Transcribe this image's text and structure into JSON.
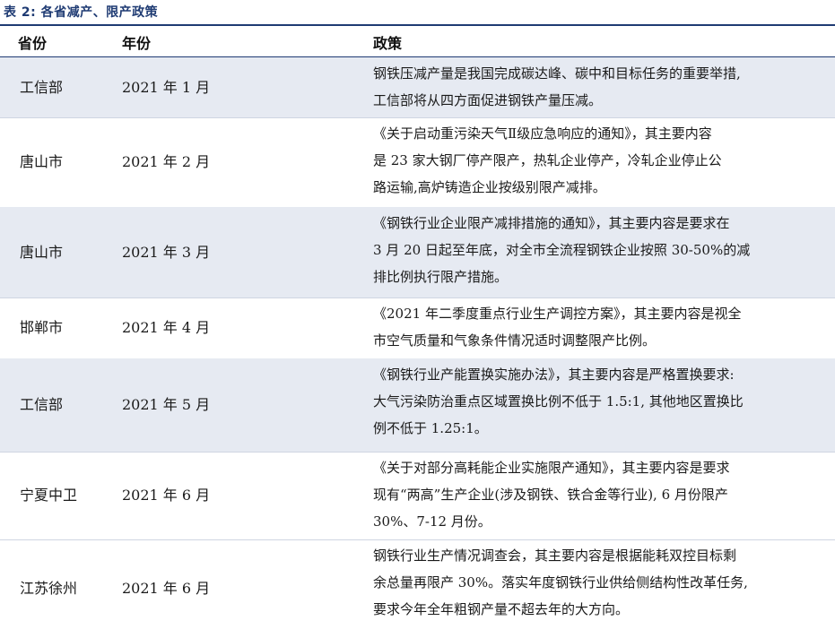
{
  "caption": "表 2: 各省减产、限产政策",
  "headers": {
    "province": "省份",
    "date": "年份",
    "policy": "政策"
  },
  "rows": [
    {
      "province": "工信部",
      "date": "2021 年 1 月",
      "lines": [
        "钢铁压减产量是我国完成碳达峰、碳中和目标任务的重要举措,",
        "工信部将从四方面促进钢铁产量压减。"
      ]
    },
    {
      "province": "唐山市",
      "date": "2021 年 2 月",
      "lines": [
        "《关于启动重污染天气Ⅱ级应急响应的通知》，其主要内容",
        "是 23 家大钢厂停产限产，热轧企业停产，冷轧企业停止公",
        "路运输,高炉铸造企业按级别限产减排。"
      ]
    },
    {
      "province": "唐山市",
      "date": "2021 年 3 月",
      "lines": [
        "《钢铁行业企业限产减排措施的通知》，其主要内容是要求在",
        "3 月 20 日起至年底，对全市全流程钢铁企业按照 30-50%的减",
        "排比例执行限产措施。"
      ]
    },
    {
      "province": "邯郸市",
      "date": "2021 年 4 月",
      "lines": [
        "《2021 年二季度重点行业生产调控方案》，其主要内容是视全",
        "市空气质量和气象条件情况适时调整限产比例。"
      ]
    },
    {
      "province": "工信部",
      "date": "2021 年 5 月",
      "lines": [
        "《钢铁行业产能置换实施办法》，其主要内容是严格置换要求:",
        "大气污染防治重点区域置换比例不低于 1.5:1, 其他地区置换比",
        "例不低于 1.25:1。"
      ]
    },
    {
      "province": "宁夏中卫",
      "date": "2021 年 6 月",
      "lines": [
        "《关于对部分高耗能企业实施限产通知》，其主要内容是要求",
        "现有“两高”生产企业(涉及钢铁、铁合金等行业), 6 月份限产",
        "30%、7-12 月份。"
      ]
    },
    {
      "province": "江苏徐州",
      "date": "2021 年 6 月",
      "lines": [
        "钢铁行业生产情况调查会，其主要内容是根据能耗双控目标剩",
        "余总量再限产 30%。落实年度钢铁行业供给侧结构性改革任务,",
        "要求今年全年粗钢产量不超去年的大方向。"
      ]
    }
  ]
}
